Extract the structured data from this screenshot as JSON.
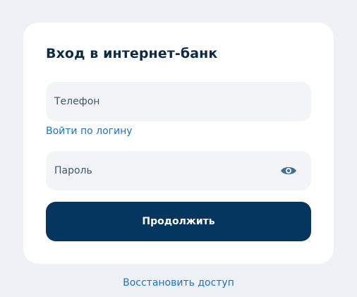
{
  "login_form": {
    "title": "Вход в интернет-банк",
    "phone_field": {
      "value": "",
      "placeholder": "Телефон"
    },
    "login_by_username_link": "Войти по логину",
    "password_field": {
      "value": "",
      "placeholder": "Пароль",
      "toggle_icon": "eye-icon"
    },
    "submit_label": "Продолжить"
  },
  "restore_access_link": "Восстановить доступ",
  "colors": {
    "page_background": "#eef1f6",
    "card_background": "#ffffff",
    "field_background": "#f2f4f8",
    "primary_button": "#05365f",
    "link": "#1a73c8",
    "title_text": "#0b2a47",
    "icon": "#3f6f95"
  }
}
